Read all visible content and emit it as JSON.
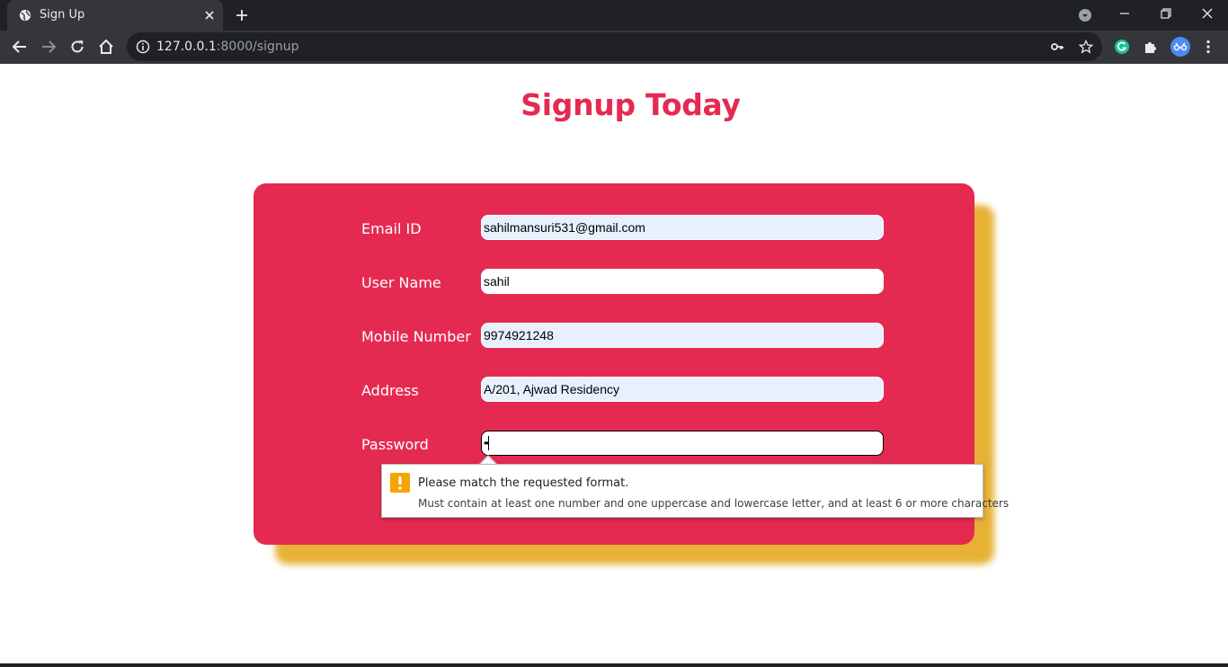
{
  "browser": {
    "tab_title": "Sign Up",
    "url_host": "127.0.0.1",
    "url_rest": ":8000/signup"
  },
  "page": {
    "heading": "Signup Today",
    "form": {
      "email_label": "Email ID",
      "email_value": "sahilmansuri531@gmail.com",
      "username_label": "User Name",
      "username_value": "sahil",
      "mobile_label": "Mobile Number",
      "mobile_value": "9974921248",
      "address_label": "Address",
      "address_value": "A/201, Ajwad Residency",
      "password_label": "Password",
      "password_value": "••"
    },
    "validation": {
      "title": "Please match the requested format.",
      "detail": "Must contain at least one number and one uppercase and lowercase letter, and at least 6 or more characters"
    }
  },
  "colors": {
    "accent": "#e52a52",
    "card_shadow": "#e5ad2a",
    "autofill": "#e8f0fe",
    "warning": "#f4a300"
  }
}
